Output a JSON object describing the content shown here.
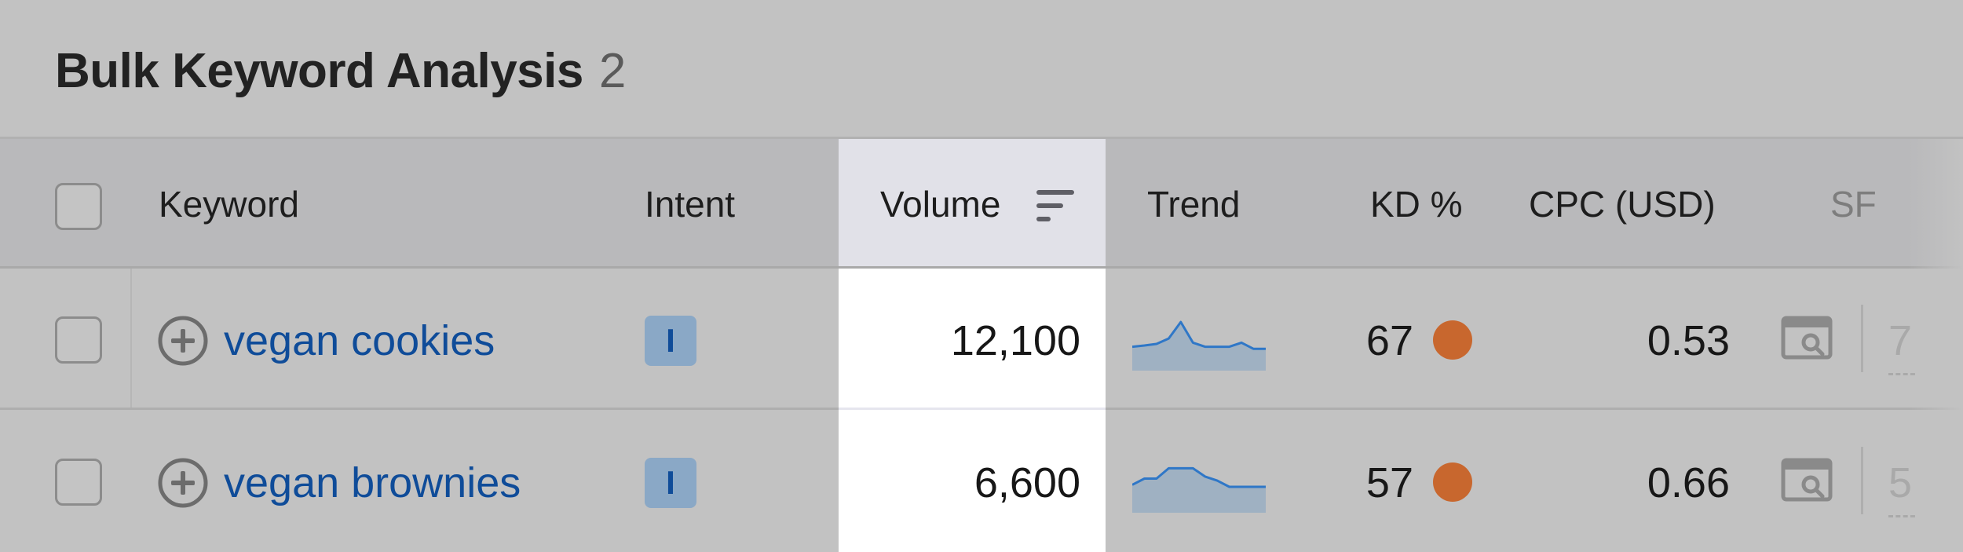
{
  "title": "Bulk Keyword Analysis",
  "title_count": "2",
  "columns": {
    "keyword": "Keyword",
    "intent": "Intent",
    "volume": "Volume",
    "trend": "Trend",
    "kd": "KD %",
    "cpc": "CPC (USD)",
    "sf": "SF"
  },
  "rows": [
    {
      "keyword": "vegan cookies",
      "intent": "I",
      "volume": "12,100",
      "kd": "67",
      "cpc": "0.53",
      "sf_partial": "7",
      "trend": [
        0.35,
        0.38,
        0.42,
        0.55,
        0.95,
        0.45,
        0.35,
        0.35,
        0.35,
        0.45,
        0.3,
        0.3
      ]
    },
    {
      "keyword": "vegan brownies",
      "intent": "I",
      "volume": "6,600",
      "kd": "57",
      "cpc": "0.66",
      "sf_partial": "5",
      "trend": [
        0.45,
        0.6,
        0.6,
        0.85,
        0.85,
        0.85,
        0.65,
        0.55,
        0.4,
        0.4,
        0.4,
        0.4
      ]
    }
  ],
  "colors": {
    "link": "#0f4c99",
    "kd_dot": "#c8672e",
    "trend_line": "#2f77c7",
    "trend_fill": "#9fb1c2",
    "intent_badge": "#8aa8c6"
  }
}
